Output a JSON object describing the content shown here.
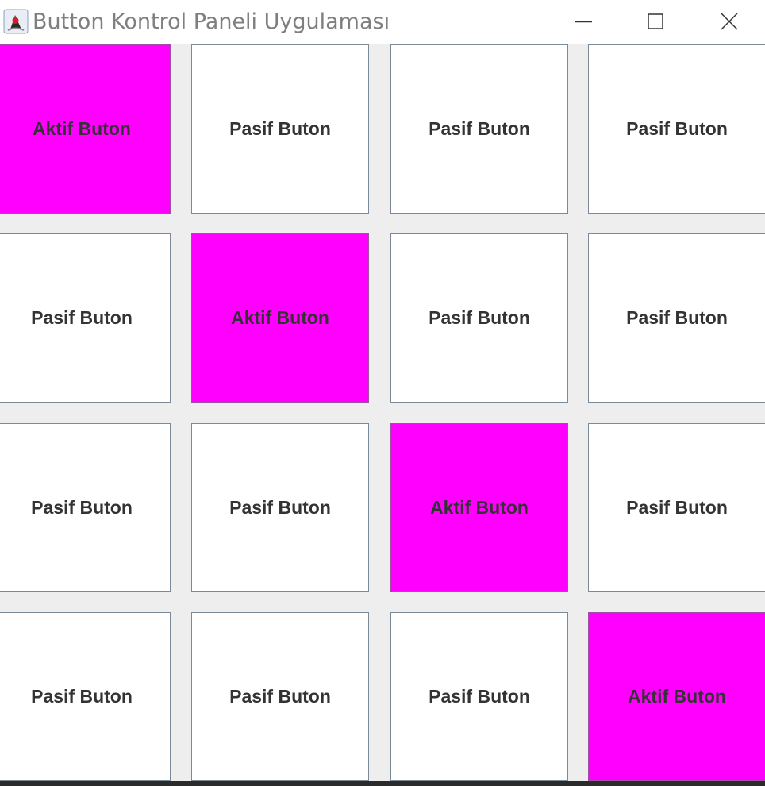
{
  "window": {
    "title": "Button Kontrol Paneli Uygulaması",
    "app_icon": "java-duke-icon",
    "controls": {
      "minimize_icon": "minimize-icon",
      "maximize_icon": "maximize-icon",
      "close_icon": "close-icon"
    }
  },
  "colors": {
    "active": "#ff00ff",
    "inactive": "#ffffff",
    "content_background": "#eeeeee",
    "button_text": "#333333"
  },
  "grid": {
    "rows": [
      [
        "Aktif Buton",
        "Pasif Buton",
        "Pasif Buton",
        "Pasif Buton"
      ],
      [
        "Pasif Buton",
        "Aktif Buton",
        "Pasif Buton",
        "Pasif Buton"
      ],
      [
        "Pasif Buton",
        "Pasif Buton",
        "Aktif Buton",
        "Pasif Buton"
      ],
      [
        "Pasif Buton",
        "Pasif Buton",
        "Pasif Buton",
        "Aktif Buton"
      ]
    ],
    "active_states": [
      [
        true,
        false,
        false,
        false
      ],
      [
        false,
        true,
        false,
        false
      ],
      [
        false,
        false,
        true,
        false
      ],
      [
        false,
        false,
        false,
        true
      ]
    ]
  }
}
